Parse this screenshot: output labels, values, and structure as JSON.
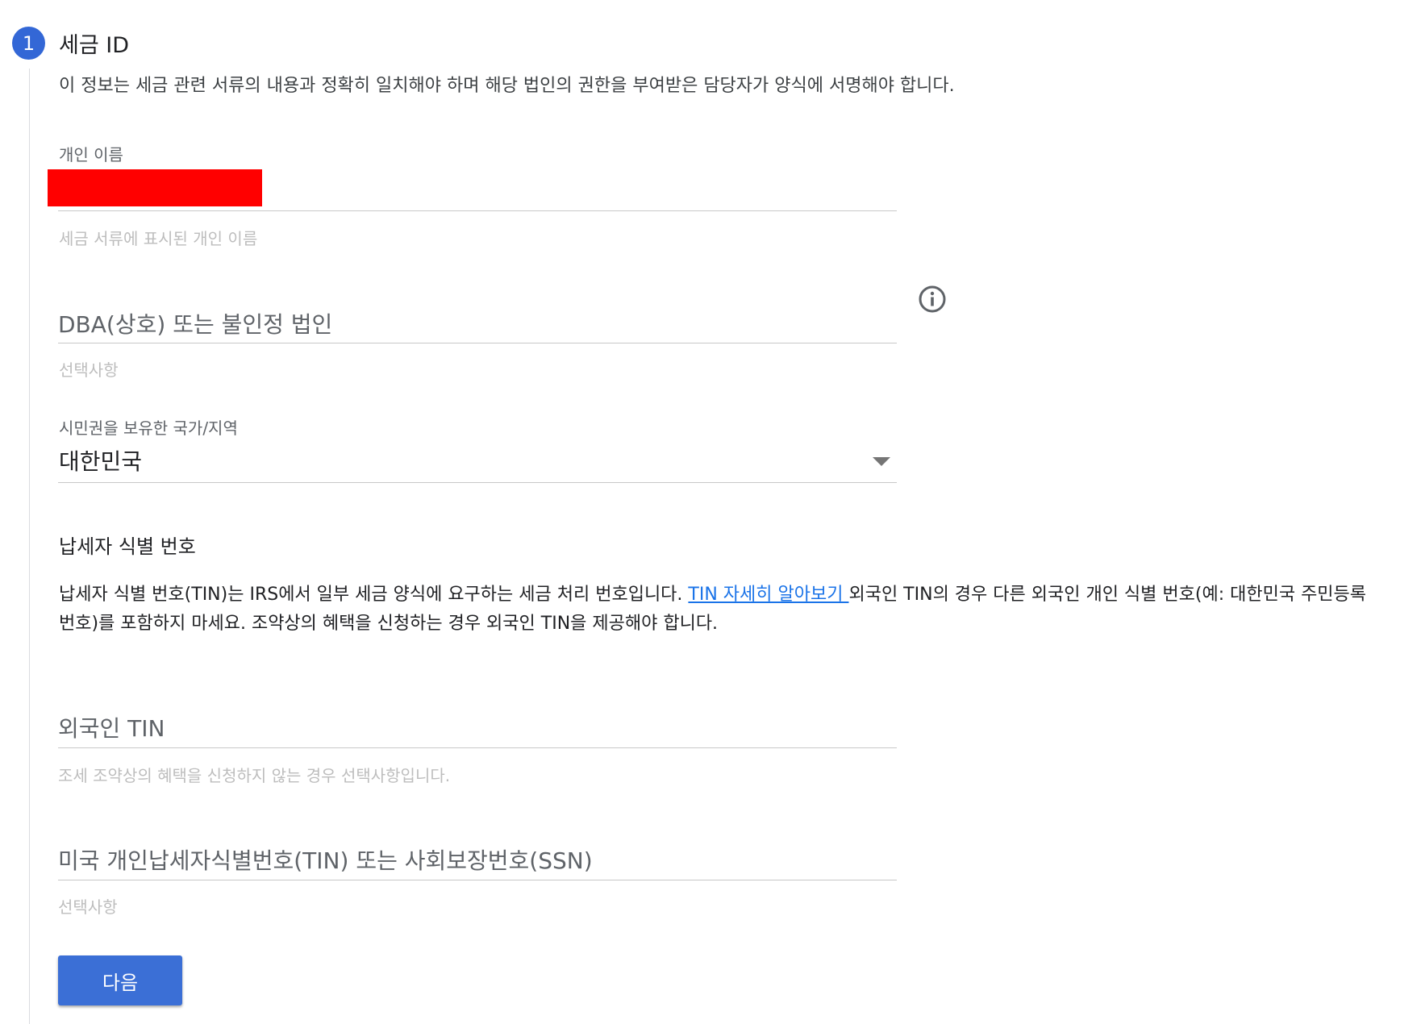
{
  "step": {
    "number": "1",
    "title": "세금 ID"
  },
  "intro": "이 정보는 세금 관련 서류의 내용과 정확히 일치해야 하며 해당 법인의 권한을 부여받은 담당자가 양식에 서명해야 합니다.",
  "individual_name": {
    "label": "개인 이름",
    "hint": "세금 서류에 표시된 개인 이름"
  },
  "dba": {
    "placeholder": "DBA(상호) 또는 불인정 법인",
    "hint": "선택사항",
    "info_icon": "info-icon"
  },
  "citizenship": {
    "label": "시민권을 보유한 국가/지역",
    "value": "대한민국"
  },
  "tin_section": {
    "title": "납세자 식별 번호",
    "text_before": "납세자 식별 번호(TIN)는 IRS에서 일부 세금 양식에 요구하는 세금 처리 번호입니다. ",
    "link": "TIN 자세히 알아보기 ",
    "text_after": "외국인 TIN의 경우 다른 외국인 개인 식별 번호(예: 대한민국 주민등록번호)를 포함하지 마세요. 조약상의 혜택을 신청하는 경우 외국인 TIN을 제공해야 합니다."
  },
  "foreign_tin": {
    "placeholder": "외국인 TIN",
    "hint": "조세 조약상의 혜택을 신청하지 않는 경우 선택사항입니다."
  },
  "us_tin": {
    "placeholder": "미국 개인납세자식별번호(TIN) 또는 사회보장번호(SSN)",
    "hint": "선택사항"
  },
  "next_button": "다음",
  "colors": {
    "accent": "#3367d6",
    "link": "#1a73e8",
    "redaction": "#ff0000"
  }
}
